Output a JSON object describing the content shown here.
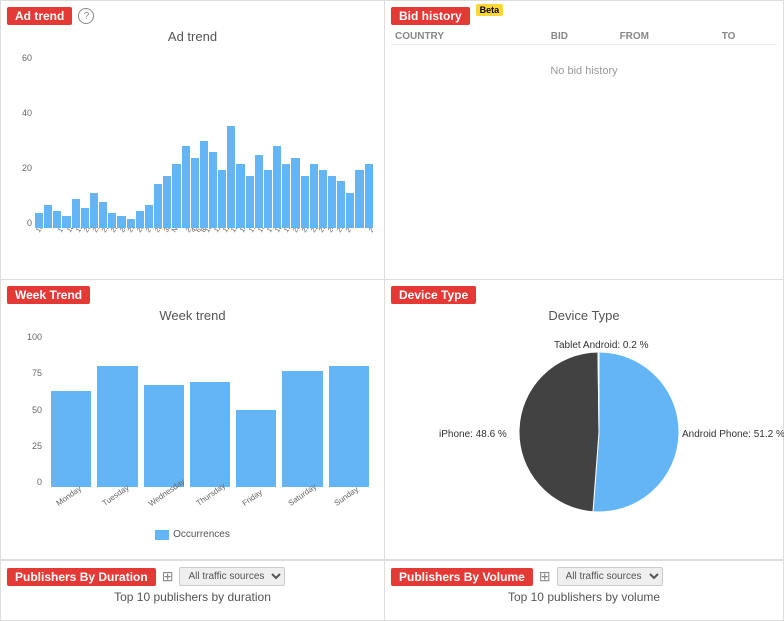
{
  "adTrend": {
    "title": "Ad trend",
    "chartTitle": "Ad trend",
    "yLabels": [
      "60",
      "40",
      "20",
      "0"
    ],
    "bars": [
      5,
      8,
      6,
      4,
      10,
      7,
      12,
      9,
      5,
      4,
      3,
      6,
      8,
      15,
      18,
      22,
      28,
      24,
      30,
      26,
      20,
      35,
      22,
      18,
      25,
      20,
      28,
      22,
      24,
      18,
      22,
      20,
      18,
      16,
      12,
      20,
      22
    ],
    "xLabels": [
      "16-Oct",
      "17",
      "18",
      "19",
      "20",
      "21",
      "22",
      "23",
      "24",
      "25",
      "26",
      "27",
      "28",
      "30",
      "Nov",
      "2",
      "4",
      "6",
      "8",
      "10",
      "11",
      "12",
      "13",
      "14",
      "15",
      "16",
      "17",
      "18",
      "19",
      "20",
      "21",
      "22",
      "23",
      "24",
      "25",
      "27-Nov",
      "28",
      "29",
      "1-Oct"
    ]
  },
  "bidHistory": {
    "title": "Bid history",
    "betaLabel": "Beta",
    "columns": [
      "COUNTRY",
      "BID",
      "FROM",
      "TO"
    ],
    "noDataMessage": "No bid history"
  },
  "weekTrend": {
    "title": "Week Trend",
    "chartTitle": "Week trend",
    "yLabels": [
      "100",
      "75",
      "50",
      "25",
      "0"
    ],
    "yAxisLabel": "Occurrences",
    "days": [
      "Monday",
      "Tuesday",
      "Wednesday",
      "Thursday",
      "Friday",
      "Saturday",
      "Sunday"
    ],
    "values": [
      62,
      78,
      66,
      68,
      50,
      75,
      78
    ],
    "legendLabel": "Occurrences"
  },
  "deviceType": {
    "title": "Device Type",
    "chartTitle": "Device Type",
    "segments": [
      {
        "label": "Android Phone: 51.2 %",
        "value": 51.2,
        "color": "#64b5f6"
      },
      {
        "label": "iPhone: 48.6 %",
        "value": 48.6,
        "color": "#424242"
      },
      {
        "label": "Tablet Android: 0.2 %",
        "value": 0.2,
        "color": "#78909c"
      }
    ]
  },
  "publishersDuration": {
    "title": "Publishers By Duration",
    "subtitle": "Top 10 publishers by duration",
    "trafficLabel": "All traffic sources",
    "tableIconLabel": "table"
  },
  "publishersVolume": {
    "title": "Publishers By Volume",
    "subtitle": "Top 10 publishers by volume",
    "trafficLabel": "All traffic sources",
    "tableIconLabel": "table"
  }
}
